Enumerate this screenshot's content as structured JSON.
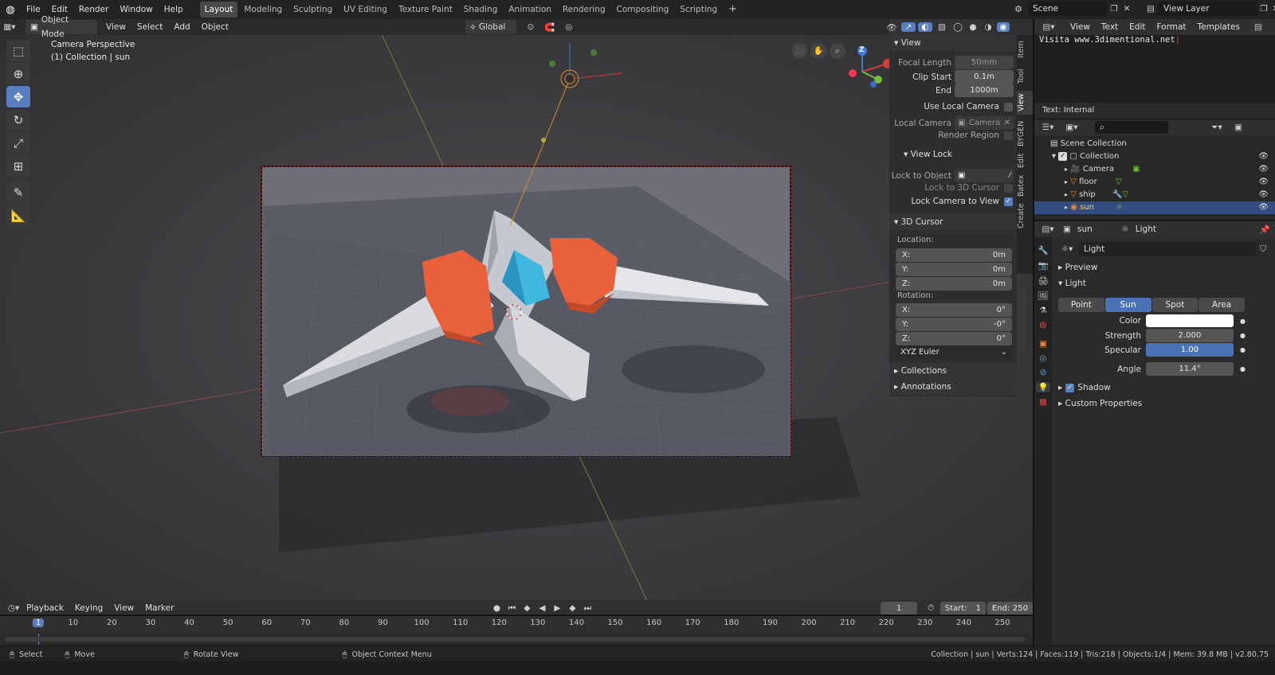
{
  "app": {
    "menus": [
      "File",
      "Edit",
      "Render",
      "Window",
      "Help"
    ],
    "workspace_tabs": [
      "Layout",
      "Modeling",
      "Sculpting",
      "UV Editing",
      "Texture Paint",
      "Shading",
      "Animation",
      "Rendering",
      "Compositing",
      "Scripting"
    ],
    "active_tab": "Layout",
    "add_tab": "+",
    "scene": "Scene",
    "view_layer": "View Layer"
  },
  "viewport": {
    "mode": "Object Mode",
    "menus": [
      "View",
      "Select",
      "Add",
      "Object"
    ],
    "orientation": "Global",
    "overlay_title": "Camera Perspective",
    "overlay_sub": "(1) Collection | sun",
    "gizmo_x": "X",
    "gizmo_z": "Z"
  },
  "npanel": {
    "view_header": "View",
    "focal_length_label": "Focal Length",
    "focal_length": "50mm",
    "clip_start_label": "Clip Start",
    "clip_start": "0.1m",
    "end_label": "End",
    "clip_end": "1000m",
    "use_local_camera": "Use Local Camera",
    "local_camera_label": "Local Camera",
    "local_camera": "Camera",
    "render_region": "Render Region",
    "view_lock_header": "View Lock",
    "lock_to_object": "Lock to Object",
    "lock_to_cursor": "Lock to 3D Cursor",
    "lock_camera": "Lock Camera to View",
    "cursor_header": "3D Cursor",
    "location_label": "Location:",
    "rotation_label": "Rotation:",
    "loc": [
      {
        "axis": "X:",
        "value": "0m"
      },
      {
        "axis": "Y:",
        "value": "0m"
      },
      {
        "axis": "Z:",
        "value": "0m"
      }
    ],
    "rot": [
      {
        "axis": "X:",
        "value": "0°"
      },
      {
        "axis": "Y:",
        "value": "-0°"
      },
      {
        "axis": "Z:",
        "value": "0°"
      }
    ],
    "rotation_mode": "XYZ Euler",
    "collections": "Collections",
    "annotations": "Annotations",
    "tabs": [
      "Item",
      "Tool",
      "View",
      "BYGEN",
      "Edit",
      "Batex",
      "Create"
    ]
  },
  "text_editor": {
    "menus": [
      "View",
      "Text",
      "Edit",
      "Format",
      "Templates"
    ],
    "content": "Visita www.3dimentional.net",
    "footer": "Text: Internal"
  },
  "outliner": {
    "root": "Scene Collection",
    "collection": "Collection",
    "items": [
      {
        "name": "Camera",
        "icon": "camera-icon"
      },
      {
        "name": "floor",
        "icon": "mesh-icon"
      },
      {
        "name": "ship",
        "icon": "mesh-icon"
      },
      {
        "name": "sun",
        "icon": "sun-icon"
      }
    ],
    "selected": "sun"
  },
  "properties": {
    "object": "sun",
    "data": "Light",
    "datablock": "Light",
    "preview": "Preview",
    "light_header": "Light",
    "types": [
      "Point",
      "Sun",
      "Spot",
      "Area"
    ],
    "active_type": "Sun",
    "color_label": "Color",
    "strength_label": "Strength",
    "strength": "2.000",
    "specular_label": "Specular",
    "specular": "1.00",
    "angle_label": "Angle",
    "angle": "11.4°",
    "shadow": "Shadow",
    "custom_props": "Custom Properties",
    "color_value": "#ffffff"
  },
  "timeline": {
    "menus": [
      "Playback",
      "Keying",
      "View",
      "Marker"
    ],
    "current_frame": "1",
    "start_label": "Start:",
    "start": "1",
    "end_label": "End:",
    "end": "250",
    "ticks": [
      "1",
      "10",
      "20",
      "30",
      "40",
      "50",
      "60",
      "70",
      "80",
      "90",
      "100",
      "110",
      "120",
      "130",
      "140",
      "150",
      "160",
      "170",
      "180",
      "190",
      "200",
      "210",
      "220",
      "230",
      "240",
      "250"
    ]
  },
  "statusbar": {
    "select": "Select",
    "move": "Move",
    "rotate_view": "Rotate View",
    "context_menu": "Object Context Menu",
    "stats": "Collection | sun | Verts:124 | Faces:119 | Tris:218 | Objects:1/4 | Mem: 39.8 MB | v2.80.75"
  },
  "colors": {
    "accent": "#5a7fc0",
    "selection": "#334d80",
    "ship_orange": "#e8613a",
    "ship_cyan": "#3fb7e0"
  }
}
